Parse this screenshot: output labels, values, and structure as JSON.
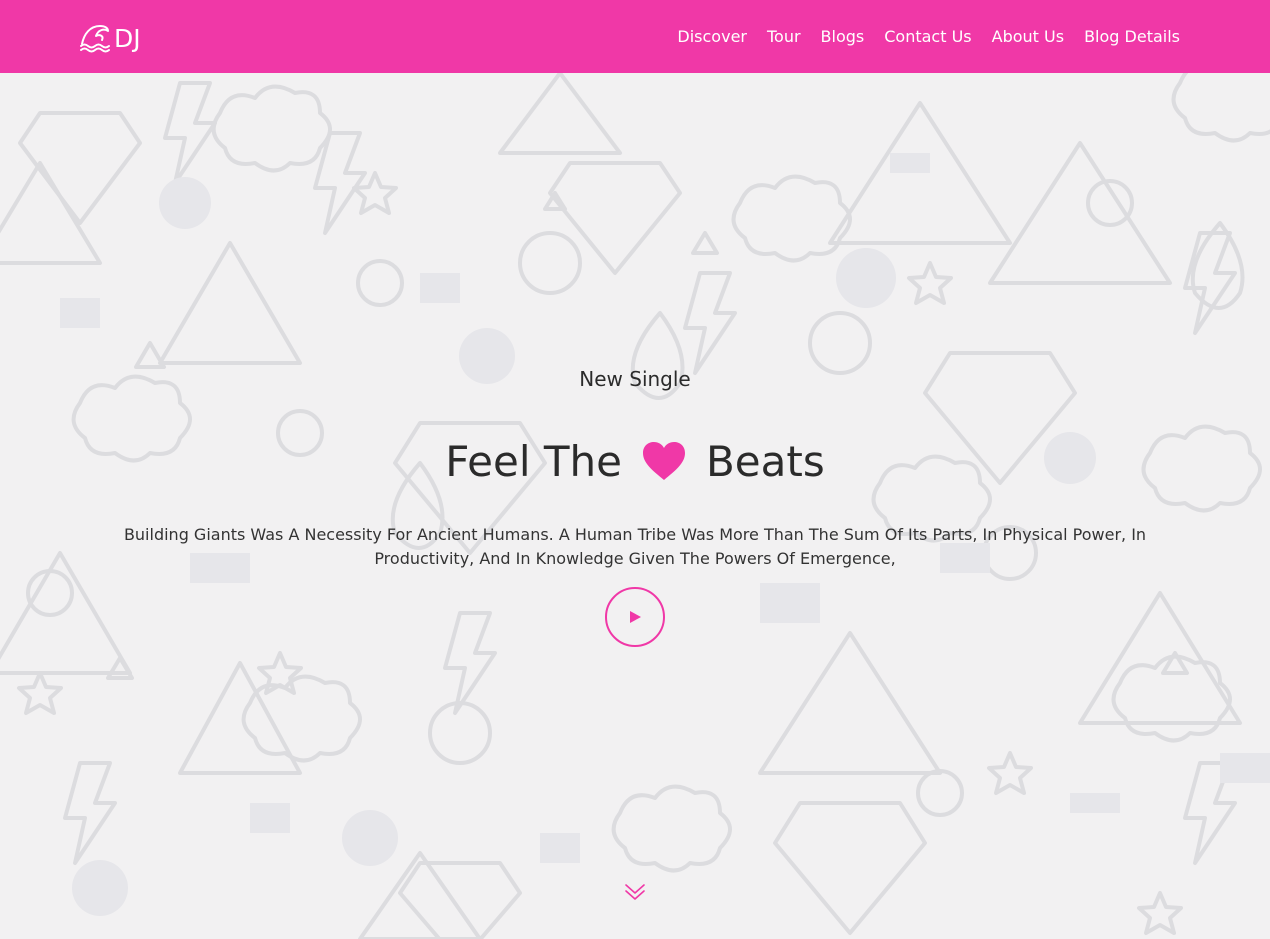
{
  "brand": {
    "logo_text": "DJ",
    "accent_color": "#f038a7"
  },
  "nav": {
    "items": [
      {
        "label": "Discover"
      },
      {
        "label": "Tour"
      },
      {
        "label": "Blogs"
      },
      {
        "label": "Contact Us"
      },
      {
        "label": "About Us"
      },
      {
        "label": "Blog Details"
      }
    ]
  },
  "hero": {
    "subtitle": "New Single",
    "title_before": "Feel The",
    "title_icon": "heart-icon",
    "title_after": "Beats",
    "description": "Building Giants Was A Necessity For Ancient Humans. A Human Tribe Was More Than The Sum Of Its Parts, In Physical Power, In Productivity, And In Knowledge Given The Powers Of Emergence,",
    "play_icon": "play-icon",
    "scroll_icon": "chevron-double-down-icon"
  }
}
